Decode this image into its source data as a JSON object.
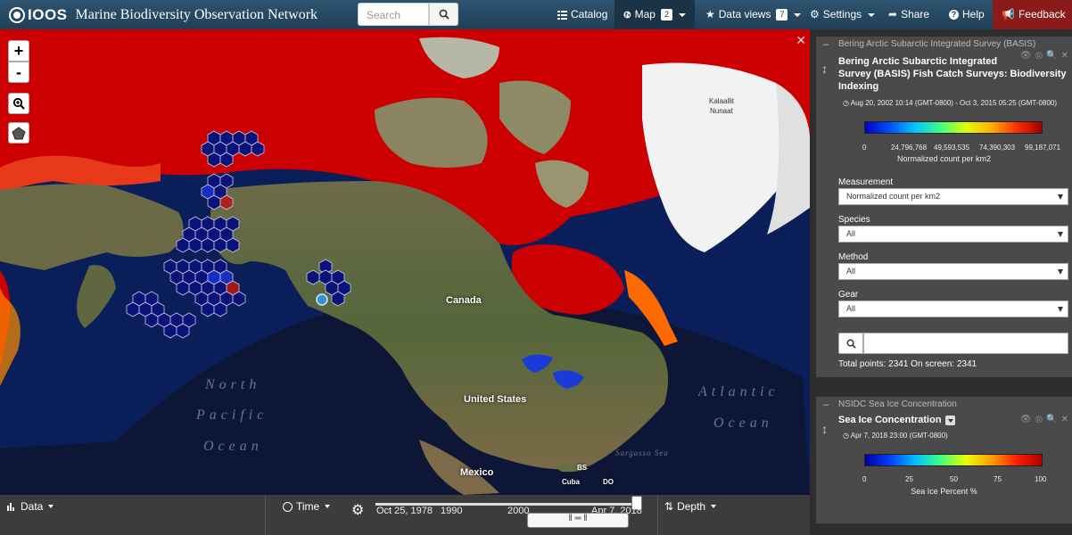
{
  "navbar": {
    "logo_text": "IOOS",
    "title": "Marine Biodiversity Observation Network",
    "search_placeholder": "Search",
    "catalog": "Catalog",
    "map": "Map",
    "map_badge": "2",
    "data_views": "Data views",
    "data_views_badge": "7",
    "settings": "Settings",
    "share": "Share",
    "help": "Help",
    "feedback": "Feedback"
  },
  "map": {
    "labels": {
      "canada": "Canada",
      "united_states": "United States",
      "mexico": "Mexico",
      "cuba": "Cuba",
      "bs": "BS",
      "do": "DO",
      "kalaallit": "Kalaallit",
      "nunaat": "Nunaat",
      "north": "North",
      "pacific": "Pacific",
      "ocean_pac": "Ocean",
      "atlantic": "Atlantic",
      "ocean_atl": "Ocean",
      "sargasso": "Sargasso Sea"
    },
    "zoom_in": "+",
    "zoom_out": "-"
  },
  "bottombar": {
    "data": "Data",
    "time": "Time",
    "depth": "Depth",
    "start_date": "Oct 25, 1978",
    "tick_1990": "1990",
    "tick_2000": "2000",
    "end_date": "Apr 7, 2018"
  },
  "layers": [
    {
      "source": "Bering Arctic Subarctic Integrated Survey (BASIS)",
      "title_line1": "Bering Arctic Subarctic Integrated",
      "title_line2": "Survey (BASIS) Fish Catch Surveys: Biodiversity",
      "title_line3": "Indexing",
      "time_range": "Aug 20, 2002 10:14 (GMT-0800) - Oct 3, 2015 05:25 (GMT-0800)",
      "legend_ticks": [
        "0",
        "24,796,768",
        "49,593,535",
        "74,390,303",
        "99,187,071"
      ],
      "legend_label": "Normalized count per km2",
      "measurement_label": "Measurement",
      "measurement_value": "Normalized count per km2",
      "species_label": "Species",
      "species_value": "All",
      "method_label": "Method",
      "method_value": "All",
      "gear_label": "Gear",
      "gear_value": "All",
      "total_points": "Total points: 2341 On screen: 2341"
    },
    {
      "source": "NSIDC Sea Ice Concentration",
      "title": "Sea Ice Concentration",
      "time": "Apr 7, 2018 23:00 (GMT-0800)",
      "legend_ticks": [
        "0",
        "25",
        "50",
        "75",
        "100"
      ],
      "legend_label": "Sea Ice Percent %"
    }
  ],
  "colors": {
    "nav_top": "#2e5470",
    "feedback": "#8b1a1a",
    "ocean": "#0a1e5a",
    "ice_high": "#cc0000",
    "panel": "#4a4a4a"
  }
}
